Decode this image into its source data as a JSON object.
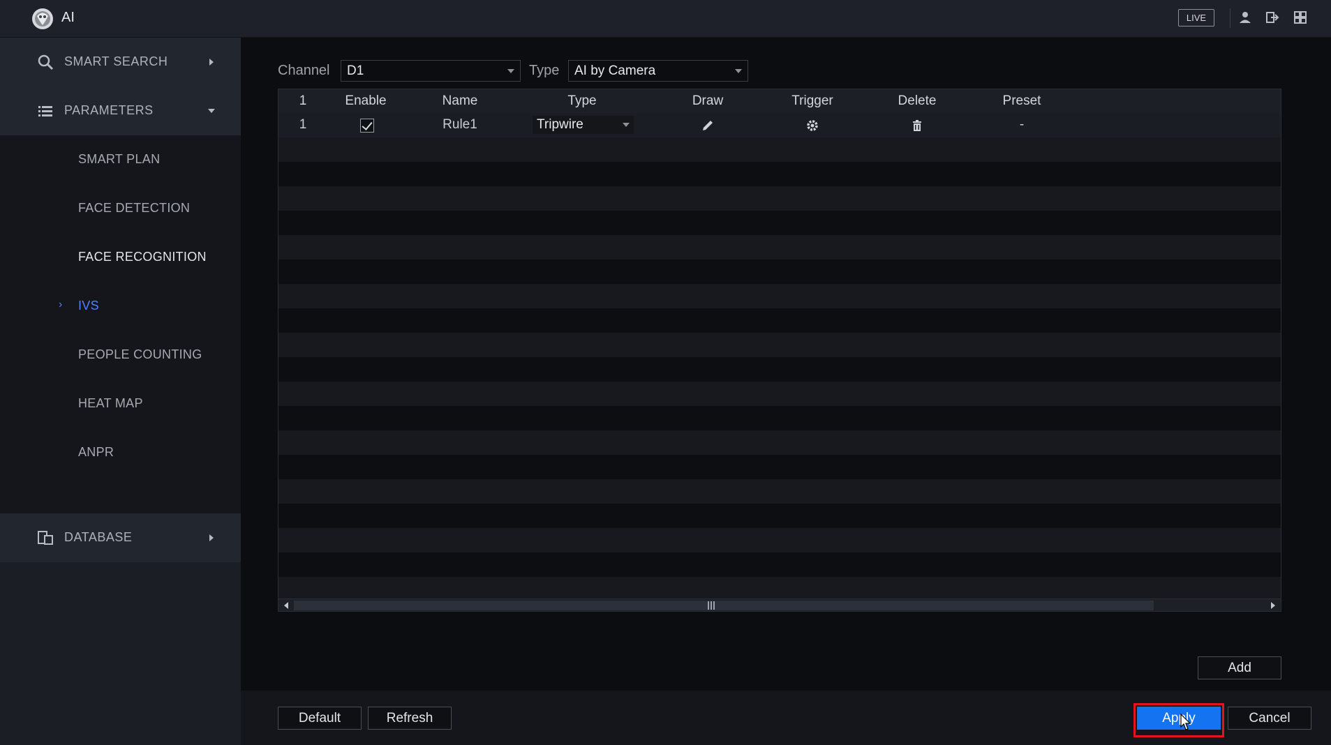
{
  "app": {
    "title": "AI",
    "live_badge": "LIVE"
  },
  "sidebar": {
    "smart_search": "SMART SEARCH",
    "parameters": "PARAMETERS",
    "database": "DATABASE",
    "sub_items": [
      "SMART PLAN",
      "FACE DETECTION",
      "FACE RECOGNITION",
      "IVS",
      "PEOPLE COUNTING",
      "HEAT MAP",
      "ANPR"
    ],
    "active_item": "IVS"
  },
  "filters": {
    "channel_label": "Channel",
    "channel_value": "D1",
    "type_label": "Type",
    "type_value": "AI by Camera"
  },
  "table": {
    "headers": [
      "1",
      "Enable",
      "Name",
      "Type",
      "Draw",
      "Trigger",
      "Delete",
      "Preset"
    ],
    "rows": [
      {
        "index": "1",
        "enabled": true,
        "name": "Rule1",
        "type": "Tripwire",
        "preset": "-"
      }
    ]
  },
  "buttons": {
    "add": "Add",
    "default": "Default",
    "refresh": "Refresh",
    "apply": "Apply",
    "cancel": "Cancel"
  },
  "colors": {
    "accent": "#1473f0",
    "active_nav": "#4b82ff",
    "highlight_box": "#e0151d"
  }
}
